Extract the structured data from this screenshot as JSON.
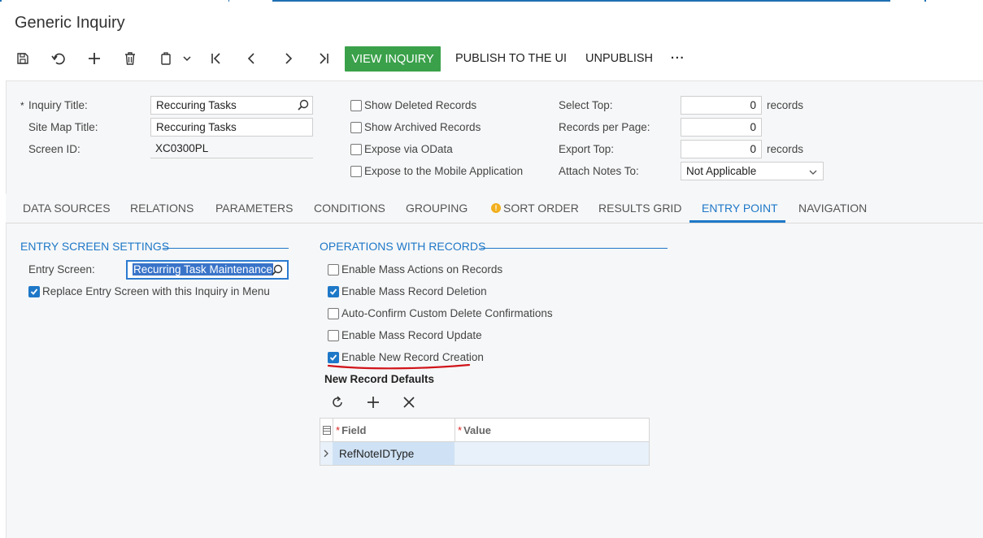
{
  "window": {
    "title": "Generic Inquiry"
  },
  "toolbar": {
    "view_inquiry": "VIEW INQUIRY",
    "publish": "PUBLISH TO THE UI",
    "unpublish": "UNPUBLISH",
    "more": "···",
    "icons": [
      "save-icon",
      "undo-icon",
      "add-icon",
      "delete-icon",
      "copy-paste-icon",
      "first-record-icon",
      "previous-record-icon",
      "next-record-icon",
      "last-record-icon"
    ]
  },
  "summary": {
    "required_mark": "*",
    "inquiry_title_label": "Inquiry Title:",
    "inquiry_title_value": "Reccuring Tasks",
    "site_map_title_label": "Site Map Title:",
    "site_map_title_value": "Reccuring Tasks",
    "screen_id_label": "Screen ID:",
    "screen_id_value": "XC0300PL",
    "show_deleted": {
      "label": "Show Deleted Records",
      "checked": false
    },
    "show_archived": {
      "label": "Show Archived Records",
      "checked": false
    },
    "expose_odata": {
      "label": "Expose via OData",
      "checked": false
    },
    "expose_mobile": {
      "label": "Expose to the Mobile Application",
      "checked": false
    },
    "select_top_label": "Select Top:",
    "select_top_value": "0",
    "select_top_unit": "records",
    "records_per_page_label": "Records per Page:",
    "records_per_page_value": "0",
    "export_top_label": "Export Top:",
    "export_top_value": "0",
    "export_top_unit": "records",
    "attach_notes_label": "Attach Notes To:",
    "attach_notes_value": "Not Applicable"
  },
  "tabs": [
    {
      "label": "DATA SOURCES",
      "active": false
    },
    {
      "label": "RELATIONS",
      "active": false
    },
    {
      "label": "PARAMETERS",
      "active": false
    },
    {
      "label": "CONDITIONS",
      "active": false
    },
    {
      "label": "GROUPING",
      "active": false
    },
    {
      "label": "SORT ORDER",
      "active": false,
      "warning": true,
      "warning_glyph": "!"
    },
    {
      "label": "RESULTS GRID",
      "active": false
    },
    {
      "label": "ENTRY POINT",
      "active": true
    },
    {
      "label": "NAVIGATION",
      "active": false
    }
  ],
  "entry_point": {
    "settings_header": "ENTRY SCREEN SETTINGS",
    "entry_screen_label": "Entry Screen:",
    "entry_screen_value": "Recurring Task Maintenance",
    "replace_entry": {
      "label": "Replace Entry Screen with this Inquiry in Menu",
      "checked": true
    },
    "operations_header": "OPERATIONS WITH RECORDS",
    "enable_mass_actions": {
      "label": "Enable Mass Actions on Records",
      "checked": false
    },
    "enable_mass_deletion": {
      "label": "Enable Mass Record Deletion",
      "checked": true
    },
    "auto_confirm": {
      "label": "Auto-Confirm Custom Delete Confirmations",
      "checked": false
    },
    "enable_mass_update": {
      "label": "Enable Mass Record Update",
      "checked": false
    },
    "enable_new_record": {
      "label": "Enable New Record Creation",
      "checked": true
    },
    "defaults_header": "New Record Defaults",
    "grid_icons": [
      "refresh-icon",
      "add-row-icon",
      "delete-row-icon"
    ],
    "grid": {
      "columns": [
        {
          "label": "Field",
          "required": true
        },
        {
          "label": "Value",
          "required": true
        }
      ],
      "required_mark": "*",
      "rows": [
        {
          "field": "RefNoteIDType",
          "value": ""
        }
      ]
    }
  },
  "colors": {
    "accent": "#1e78c8",
    "primary_button": "#3aa14a",
    "annotation_red": "#d0141a",
    "warning": "#f2b01e"
  }
}
